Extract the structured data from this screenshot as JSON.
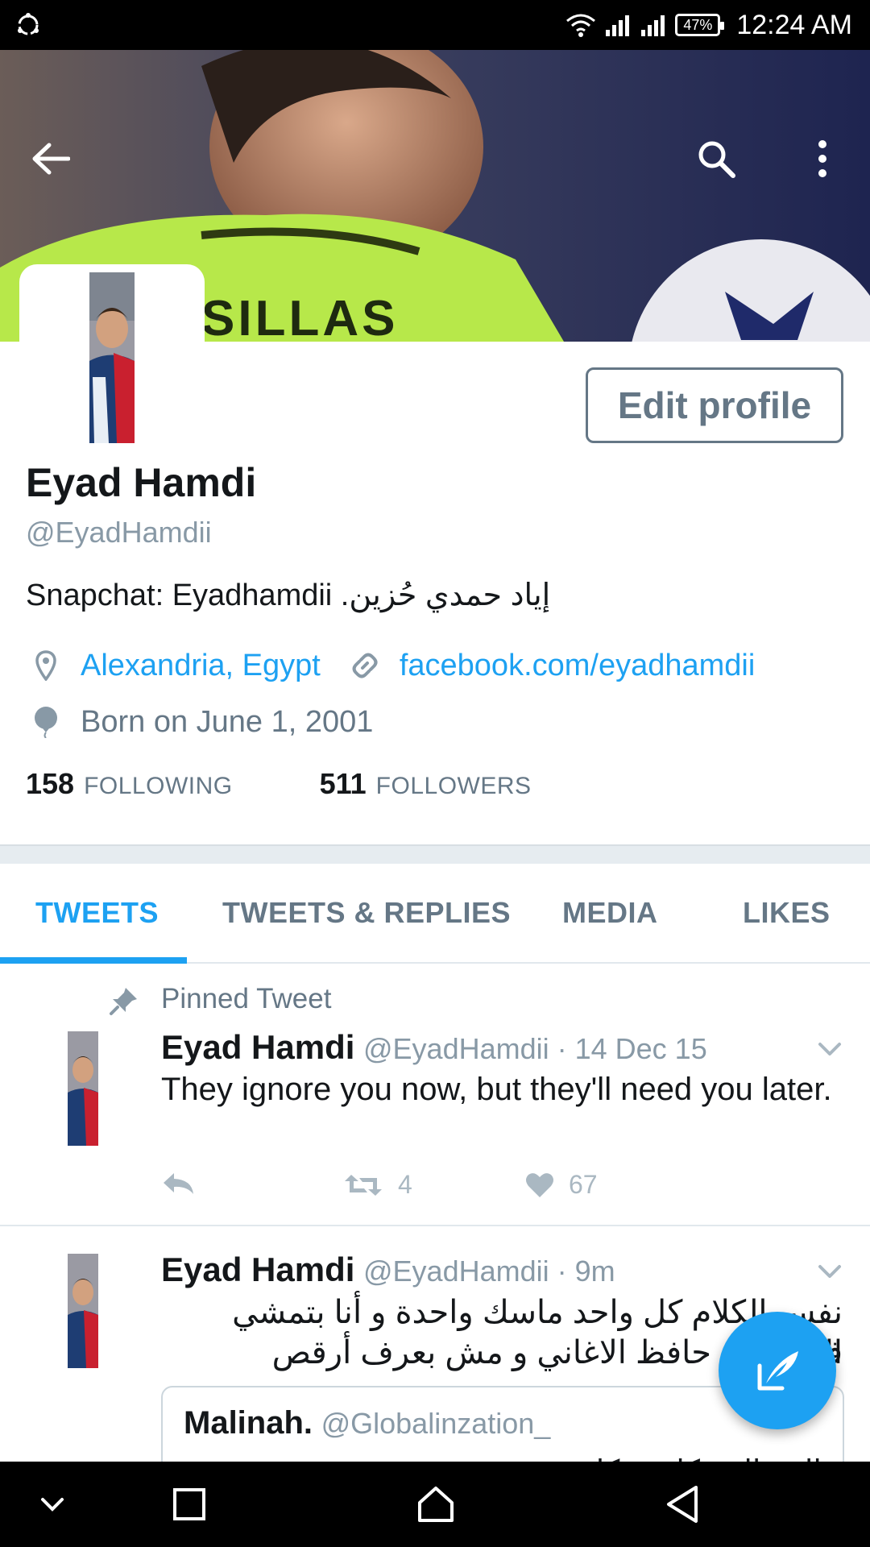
{
  "status_bar": {
    "time": "12:24 AM",
    "battery": "47%",
    "icons": [
      "sync-icon",
      "wifi-icon",
      "signal-icon",
      "signal-icon",
      "battery-icon"
    ]
  },
  "header": {
    "back_icon": "back-arrow-icon",
    "search_icon": "search-icon",
    "menu_icon": "more-vertical-icon",
    "banner_text": "SILLAS"
  },
  "profile": {
    "edit_label": "Edit profile",
    "name": "Eyad Hamdi",
    "handle": "@EyadHamdii",
    "bio": "Snapchat: Eyadhamdii .إياد حمدي حُزين",
    "location": "Alexandria, Egypt",
    "website": "facebook.com/eyadhamdii",
    "birthday": "Born on June 1, 2001",
    "following_count": "158",
    "following_label": "FOLLOWING",
    "followers_count": "511",
    "followers_label": "FOLLOWERS",
    "colors": {
      "link": "#1da1f2",
      "secondary": "#657786"
    }
  },
  "tabs": [
    {
      "label": "TWEETS",
      "active": true
    },
    {
      "label": "TWEETS & REPLIES",
      "active": false
    },
    {
      "label": "MEDIA",
      "active": false
    },
    {
      "label": "LIKES",
      "active": false
    }
  ],
  "tweets": [
    {
      "pinned_label": "Pinned Tweet",
      "name": "Eyad Hamdi",
      "meta": "@EyadHamdii · 14 Dec 15",
      "text": "They ignore you now, but they'll need you later.",
      "retweets": "4",
      "likes": "67"
    },
    {
      "name": "Eyad Hamdi",
      "meta": "@EyadHamdii · 9m",
      "text_line1": "نفس الكلام كل واحد ماسك واحدة و أنا بتمشي في",
      "text_line2": "الـ... مش حافظ الاغاني و مش بعرف أرقص",
      "quote": {
        "name": "Malinah.",
        "handle": "@Globalinzation_",
        "text": "الـ... الـ... كل ... كل ..."
      }
    }
  ],
  "fab": {
    "icon": "compose-tweet-icon"
  },
  "nav_bar": {
    "icons": [
      "chevron-down-icon",
      "recents-icon",
      "home-icon",
      "back-triangle-icon"
    ]
  }
}
